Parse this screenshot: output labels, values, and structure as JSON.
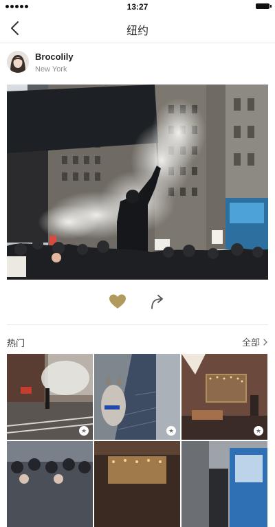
{
  "status_bar": {
    "time": "13:27"
  },
  "nav": {
    "title": "纽约"
  },
  "post": {
    "author_name": "Brocolily",
    "author_location": "New York"
  },
  "popular": {
    "title": "热门",
    "see_all": "全部"
  },
  "colors": {
    "like_gold": "#b19a5e",
    "share_gray": "#555555"
  },
  "icons": {
    "back": "chevron-left-icon",
    "like": "heart-icon",
    "share": "share-arrow-icon",
    "see_all": "chevron-right-icon",
    "badge": "star-icon"
  }
}
